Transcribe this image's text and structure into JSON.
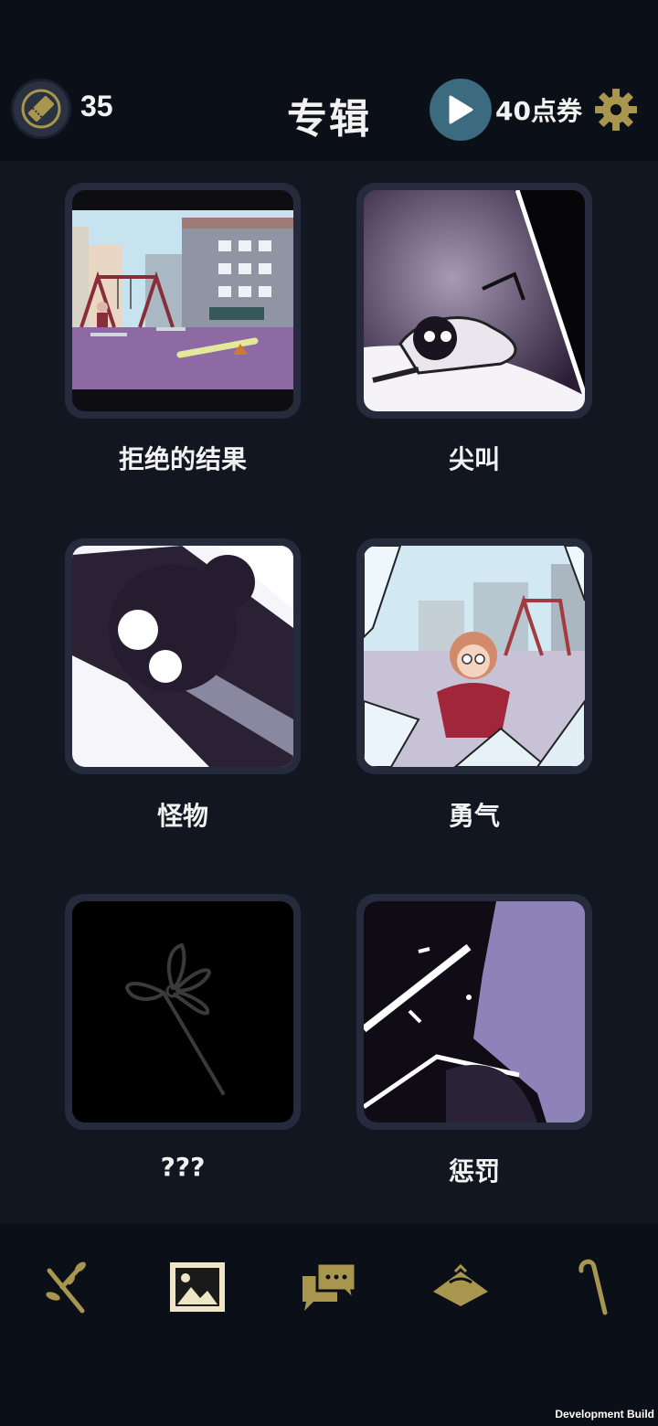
{
  "header": {
    "ticket_count": "35",
    "title": "专辑",
    "points": "40点券"
  },
  "icons": {
    "ticket": "ticket-icon",
    "play": "play-icon",
    "settings": "gear-icon"
  },
  "albums": [
    {
      "label": "拒绝的结果"
    },
    {
      "label": "尖叫"
    },
    {
      "label": "怪物"
    },
    {
      "label": "勇气"
    },
    {
      "label": "???"
    },
    {
      "label": "惩罚"
    }
  ],
  "bottom_nav": [
    {
      "icon": "branch-icon",
      "active": false
    },
    {
      "icon": "gallery-icon",
      "active": true
    },
    {
      "icon": "chat-icon",
      "active": false
    },
    {
      "icon": "hat-icon",
      "active": false
    },
    {
      "icon": "cane-icon",
      "active": false
    }
  ],
  "footer": {
    "dev_label": "Development Build"
  },
  "colors": {
    "accent_gold": "#a8964e",
    "background": "#121620",
    "card": "#252b3d"
  }
}
